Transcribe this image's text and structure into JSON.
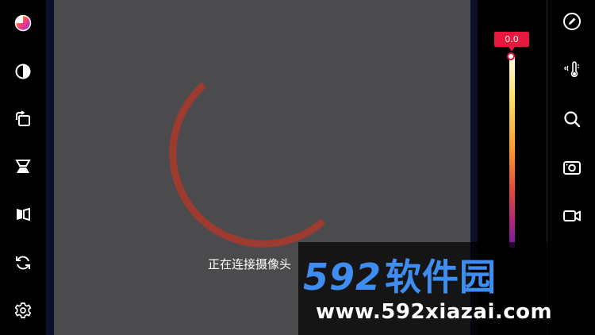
{
  "left_toolbar": [
    {
      "name": "palette-icon"
    },
    {
      "name": "contrast-icon"
    },
    {
      "name": "rotate-icon"
    },
    {
      "name": "flip-vertical-icon"
    },
    {
      "name": "mirror-icon"
    },
    {
      "name": "refresh-icon"
    },
    {
      "name": "settings-icon"
    }
  ],
  "right_toolbar": [
    {
      "name": "edit-icon"
    },
    {
      "name": "thermometer-icon"
    },
    {
      "name": "search-icon"
    },
    {
      "name": "camera-icon"
    },
    {
      "name": "video-icon"
    }
  ],
  "temperature": {
    "marker_value": "0.0"
  },
  "status": {
    "text": "正在连接摄像头"
  },
  "watermark": {
    "number": "592",
    "brand": "软件园",
    "url": "www.592xiazai.com"
  },
  "colors": {
    "spinner": "#9e3b30",
    "marker": "#e8173d",
    "viewport": "#4b4b4d",
    "watermark": "#3d8ef0"
  }
}
